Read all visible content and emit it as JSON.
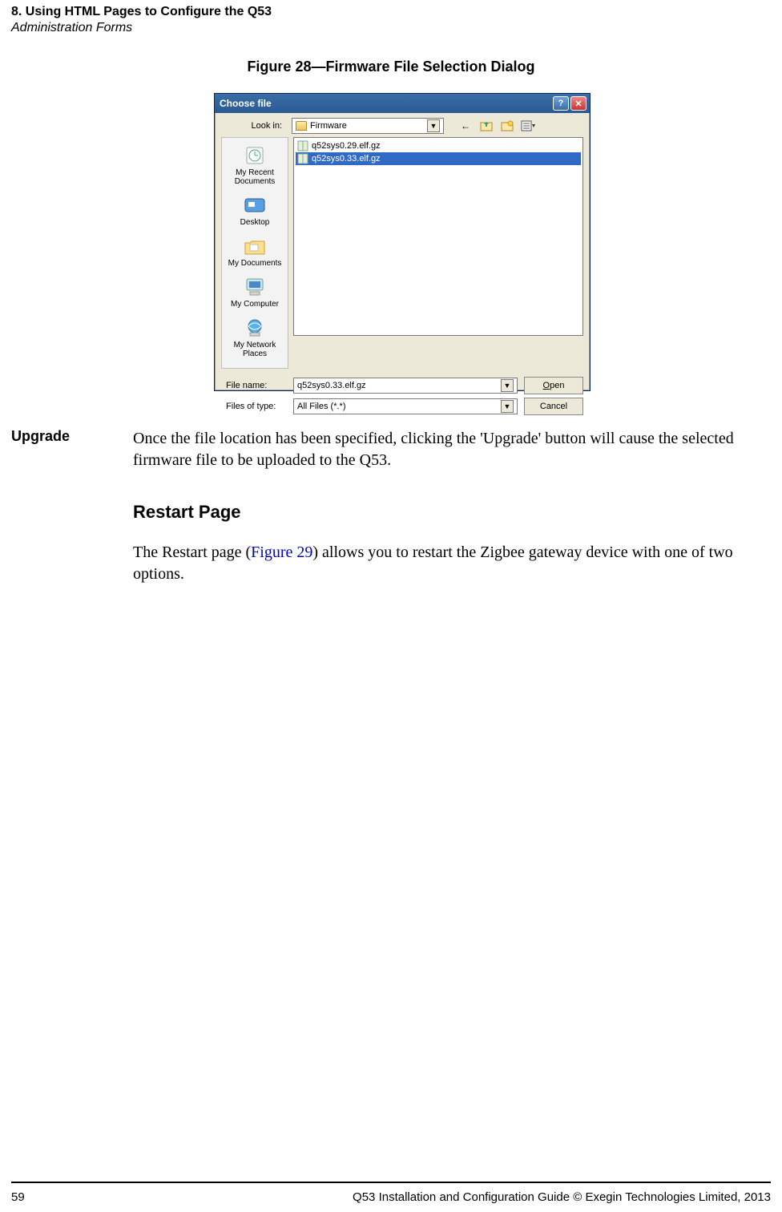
{
  "header": {
    "line1": "8. Using HTML Pages to Configure the Q53",
    "line2": "Administration Forms"
  },
  "figure": {
    "caption": "Figure 28—Firmware File Selection Dialog"
  },
  "dialog": {
    "title": "Choose file",
    "lookin_label": "Look in:",
    "lookin_value": "Firmware",
    "places": {
      "recent": "My Recent Documents",
      "desktop": "Desktop",
      "mydocs": "My Documents",
      "mycomp": "My Computer",
      "network": "My Network Places"
    },
    "files": [
      {
        "name": "q52sys0.29.elf.gz",
        "selected": false
      },
      {
        "name": "q52sys0.33.elf.gz",
        "selected": true
      }
    ],
    "filename_label": "File name:",
    "filename_value": "q52sys0.33.elf.gz",
    "filetype_label": "Files of type:",
    "filetype_value": "All Files (*.*)",
    "open_label_pre": "O",
    "open_label_rest": "pen",
    "cancel_label": "Cancel"
  },
  "content": {
    "upgrade_label": "Upgrade",
    "upgrade_text": "Once the file location has been specified, clicking the 'Upgrade' button will cause the selected firmware file to be uploaded to the Q53.",
    "restart_heading": "Restart Page",
    "restart_para_pre": "The Restart page (",
    "restart_link": "Figure 29",
    "restart_para_post": ") allows you to restart the Zigbee gateway device with one of two options."
  },
  "footer": {
    "page": "59",
    "text": "Q53 Installation and Configuration Guide  © Exegin Technologies Limited, 2013"
  }
}
